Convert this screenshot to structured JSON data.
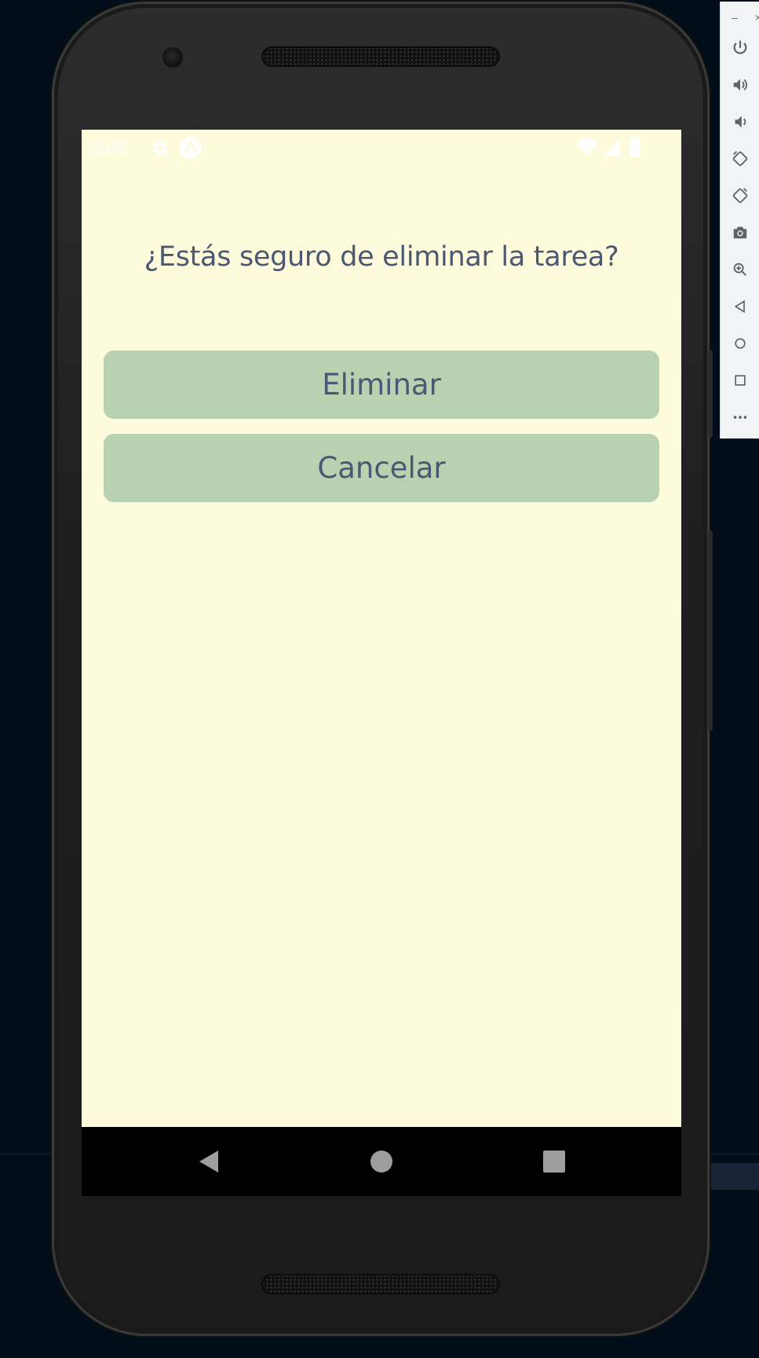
{
  "statusbar": {
    "time": "5:05",
    "icons": [
      "gear-icon",
      "android-logo-icon",
      "wifi-icon",
      "cell-signal-icon",
      "battery-icon"
    ]
  },
  "dialog": {
    "question": "¿Estás seguro de eliminar la tarea?",
    "delete_label": "Eliminar",
    "cancel_label": "Cancelar"
  },
  "navbar": {
    "icons": [
      "back-icon",
      "home-icon",
      "recents-icon"
    ]
  },
  "emulator_toolbar": {
    "window_controls": [
      "minimize-icon",
      "close-icon"
    ],
    "controls": [
      "power-icon",
      "volume-up-icon",
      "volume-down-icon",
      "rotate-left-icon",
      "rotate-right-icon",
      "camera-icon",
      "zoom-icon",
      "back-icon",
      "home-icon",
      "overview-icon",
      "more-icon"
    ]
  },
  "colors": {
    "screen_background": "#fefadc",
    "button_background": "#b8d1b0",
    "text": "#4b5872",
    "desktop_background": "#020d1a"
  }
}
